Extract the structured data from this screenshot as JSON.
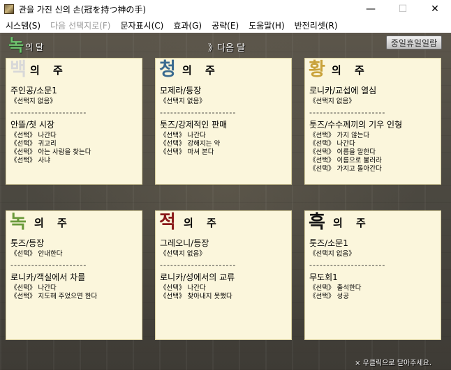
{
  "window": {
    "title": "관을 가진 신의 손(冠を持つ神の手)",
    "minimize": "—",
    "maximize": "☐",
    "close": "✕"
  },
  "menu": {
    "items": [
      {
        "label": "시스템(S)",
        "enabled": true
      },
      {
        "label": "다음 선택지로(F)",
        "enabled": false
      },
      {
        "label": "문자표시(C)",
        "enabled": true
      },
      {
        "label": "효과(G)",
        "enabled": true
      },
      {
        "label": "공략(E)",
        "enabled": true
      },
      {
        "label": "도움말(H)",
        "enabled": true
      },
      {
        "label": "반전리셋(R)",
        "enabled": true
      }
    ]
  },
  "header": {
    "month_big": "녹",
    "month_small": "의 달",
    "next_month": "》다음 달",
    "holiday_button": "중일휴일일람"
  },
  "footer": {
    "hint": "× 우클릭으로 닫아주세요."
  },
  "divider_text": "----------------------",
  "panels": [
    {
      "big": "백",
      "rest": "의 주",
      "color": "#d8d8d8",
      "first_title": "주인공/소문1",
      "first_options": [
        "《선택지 없음》"
      ],
      "second_title": "안뜰/첫 시장",
      "second_options": [
        "《선택》 나간다",
        "《선택》 귀고리",
        "《선택》 아는 사람을 찾는다",
        "《선택》 사냐"
      ]
    },
    {
      "big": "청",
      "rest": "의 주",
      "color": "#3a6b8f",
      "first_title": "모제라/등장",
      "first_options": [
        "《선택지 없음》"
      ],
      "second_title": "툿즈/강제적인 판매",
      "second_options": [
        "《선택》 나간다",
        "《선택》 강해지는 약",
        "《선택》 마셔 본다"
      ]
    },
    {
      "big": "황",
      "rest": "의 주",
      "color": "#c9a23a",
      "first_title": "로니카/교섭에 열심",
      "first_options": [
        "《선택지 없음》"
      ],
      "second_title": "툿즈/수수께끼의 기우 인형",
      "second_options": [
        "《선택》 가지 않는다",
        "《선택》 나간다",
        "《선택》 이름을 말한다",
        "《선택》 이름으로 불러라",
        "《선택》 가지고 돌아간다"
      ]
    },
    {
      "big": "녹",
      "rest": "의 주",
      "color": "#6a9a3a",
      "first_title": "툿즈/등장",
      "first_options": [
        "《선택》 안내한다"
      ],
      "second_title": "로니카/객실에서 차를",
      "second_options": [
        "《선택》 나간다",
        "《선택》 지도해 주었으면 한다"
      ]
    },
    {
      "big": "적",
      "rest": "의 주",
      "color": "#8a1a1a",
      "first_title": "그레오니/등장",
      "first_options": [
        "《선택지 없음》"
      ],
      "second_title": "로니카/성에서의 교류",
      "second_options": [
        "《선택》 나간다",
        "《선택》 찾아내지 못했다"
      ]
    },
    {
      "big": "흑",
      "rest": "의 주",
      "color": "#111111",
      "first_title": "툿즈/소문1",
      "first_options": [
        "《선택지 없음》"
      ],
      "second_title": "무도회1",
      "second_options": [
        "《선택》 출석한다",
        "《선택》 성공"
      ]
    }
  ]
}
